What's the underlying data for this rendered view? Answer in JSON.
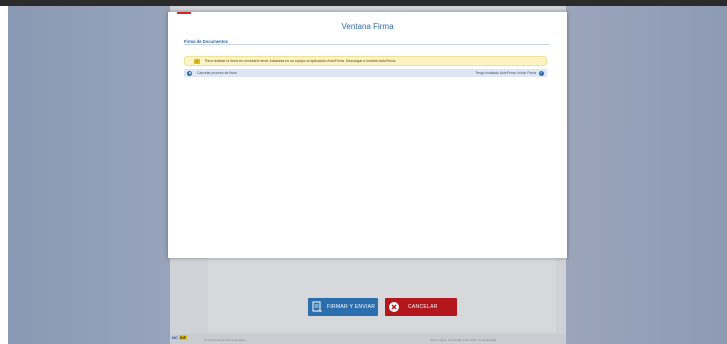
{
  "modal": {
    "title": "Ventana Firma",
    "section_title": "Firma de Documentos",
    "warning": {
      "icon": "warning-icon",
      "text": "Para realizar la firma es necesario tener instalada en su equipo la aplicación AutoFirma. Descargar e instalar AutoFirma"
    },
    "status": {
      "left_icon": "gear-icon",
      "left_text": "Cancelar proceso de firma",
      "right_text": "Tengo instalado AutoFirma. Iniciar Firma",
      "right_icon": "check-circle-icon"
    }
  },
  "buttons": {
    "firmar": "FIRMAR Y ENVIAR",
    "cancelar": "CANCELAR"
  },
  "footer": {
    "badge": "NC",
    "badge_yellow": "INF",
    "left_text": "Todos los derechos reservados",
    "right_text": "Aviso Legal | Privacidad | Contacto | Accesibilidad"
  },
  "colors": {
    "accent_blue": "#2f6aa8",
    "accent_red": "#b3171d",
    "warning_bg": "#fdf3c4"
  }
}
